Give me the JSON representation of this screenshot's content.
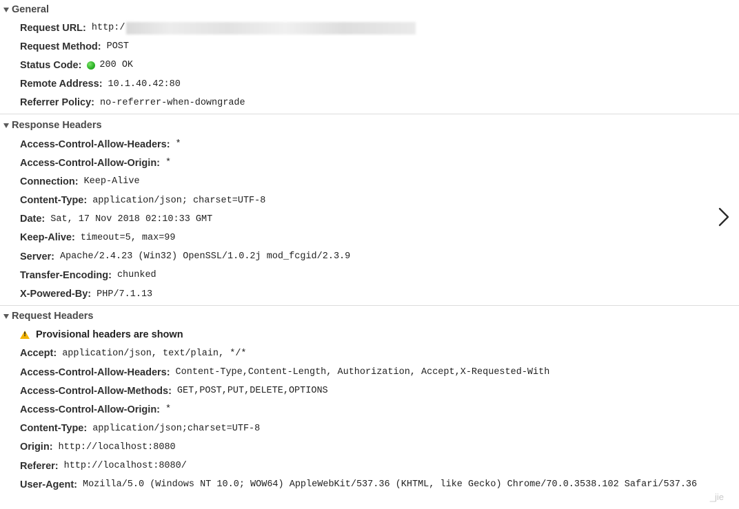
{
  "general": {
    "title": "General",
    "request_url": {
      "key": "Request URL:",
      "value": "http:/"
    },
    "request_method": {
      "key": "Request Method:",
      "value": "POST"
    },
    "status_code": {
      "key": "Status Code:",
      "value": "200 OK",
      "status_color": "#2fb52a"
    },
    "remote_address": {
      "key": "Remote Address:",
      "value": "10.1.40.42:80"
    },
    "referrer_policy": {
      "key": "Referrer Policy:",
      "value": "no-referrer-when-downgrade"
    }
  },
  "response_headers": {
    "title": "Response Headers",
    "rows": [
      {
        "key": "Access-Control-Allow-Headers:",
        "value": "*"
      },
      {
        "key": "Access-Control-Allow-Origin:",
        "value": "*"
      },
      {
        "key": "Connection:",
        "value": "Keep-Alive"
      },
      {
        "key": "Content-Type:",
        "value": "application/json; charset=UTF-8"
      },
      {
        "key": "Date:",
        "value": "Sat, 17 Nov 2018 02:10:33 GMT"
      },
      {
        "key": "Keep-Alive:",
        "value": "timeout=5, max=99"
      },
      {
        "key": "Server:",
        "value": "Apache/2.4.23 (Win32) OpenSSL/1.0.2j mod_fcgid/2.3.9"
      },
      {
        "key": "Transfer-Encoding:",
        "value": "chunked"
      },
      {
        "key": "X-Powered-By:",
        "value": "PHP/7.1.13"
      }
    ]
  },
  "request_headers": {
    "title": "Request Headers",
    "warning": "Provisional headers are shown",
    "warning_color": "#f4b400",
    "rows": [
      {
        "key": "Accept:",
        "value": "application/json, text/plain, */*"
      },
      {
        "key": "Access-Control-Allow-Headers:",
        "value": "Content-Type,Content-Length, Authorization, Accept,X-Requested-With"
      },
      {
        "key": "Access-Control-Allow-Methods:",
        "value": "GET,POST,PUT,DELETE,OPTIONS"
      },
      {
        "key": "Access-Control-Allow-Origin:",
        "value": "*"
      },
      {
        "key": "Content-Type:",
        "value": "application/json;charset=UTF-8"
      },
      {
        "key": "Origin:",
        "value": "http://localhost:8080"
      },
      {
        "key": "Referer:",
        "value": "http://localhost:8080/"
      },
      {
        "key": "User-Agent:",
        "value": "Mozilla/5.0 (Windows NT 10.0; WOW64) AppleWebKit/537.36 (KHTML, like Gecko) Chrome/70.0.3538.102 Safari/537.36"
      }
    ]
  },
  "icons": {
    "collapse": "triangle-down-icon",
    "status": "green-dot-icon",
    "warning": "warning-icon",
    "next": "chevron-right-icon"
  },
  "watermark": "_jie"
}
